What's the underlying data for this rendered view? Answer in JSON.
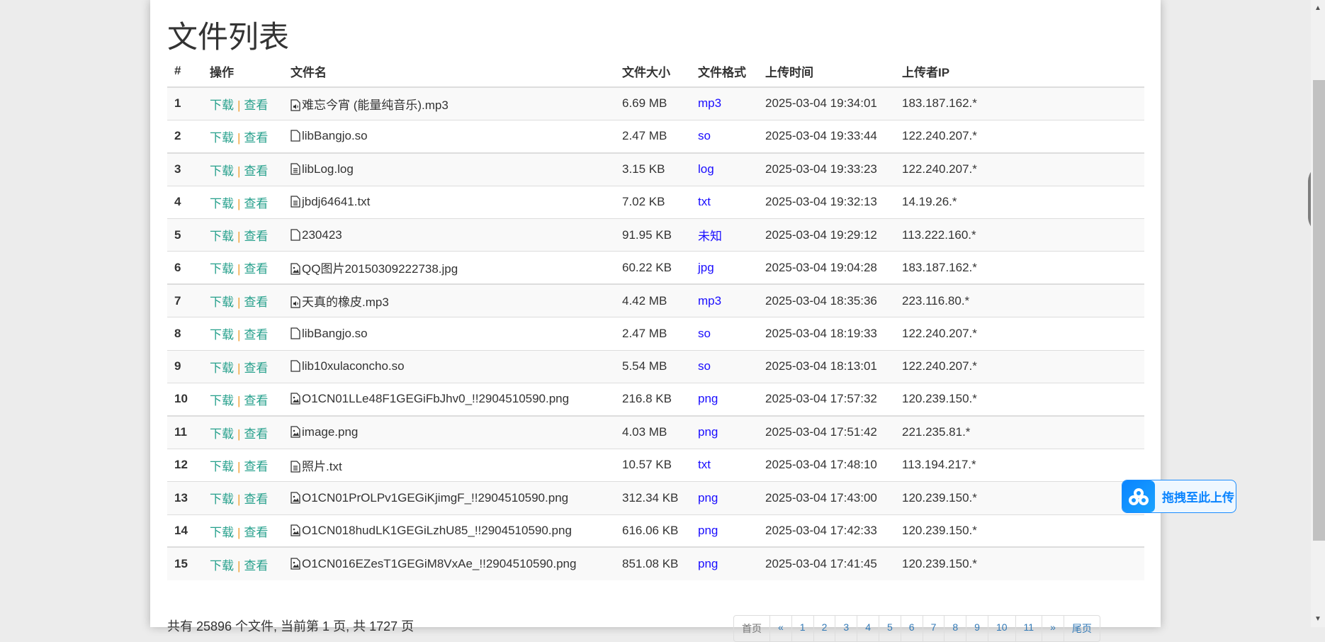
{
  "page_title": "文件列表",
  "headers": [
    "#",
    "操作",
    "文件名",
    "文件大小",
    "文件格式",
    "上传时间",
    "上传者IP"
  ],
  "actions": {
    "download": "下载",
    "separator": "|",
    "view": "查看"
  },
  "rows": [
    {
      "n": "1",
      "icon": "audio-file",
      "name": "难忘今宵 (能量纯音乐).mp3",
      "size": "6.69 MB",
      "fmt": "mp3",
      "time": "2025-03-04 19:34:01",
      "ip": "183.187.162.*"
    },
    {
      "n": "2",
      "icon": "blank-file",
      "name": "libBangjo.so",
      "size": "2.47 MB",
      "fmt": "so",
      "time": "2025-03-04 19:33:44",
      "ip": "122.240.207.*"
    },
    {
      "n": "3",
      "icon": "text-file",
      "name": "libLog.log",
      "size": "3.15 KB",
      "fmt": "log",
      "time": "2025-03-04 19:33:23",
      "ip": "122.240.207.*"
    },
    {
      "n": "4",
      "icon": "text-file",
      "name": "jbdj64641.txt",
      "size": "7.02 KB",
      "fmt": "txt",
      "time": "2025-03-04 19:32:13",
      "ip": "14.19.26.*"
    },
    {
      "n": "5",
      "icon": "blank-file",
      "name": "230423",
      "size": "91.95 KB",
      "fmt": "未知",
      "time": "2025-03-04 19:29:12",
      "ip": "113.222.160.*"
    },
    {
      "n": "6",
      "icon": "image-file",
      "name": "QQ图片20150309222738.jpg",
      "size": "60.22 KB",
      "fmt": "jpg",
      "time": "2025-03-04 19:04:28",
      "ip": "183.187.162.*"
    },
    {
      "n": "7",
      "icon": "audio-file",
      "name": "天真的橡皮.mp3",
      "size": "4.42 MB",
      "fmt": "mp3",
      "time": "2025-03-04 18:35:36",
      "ip": "223.116.80.*"
    },
    {
      "n": "8",
      "icon": "blank-file",
      "name": "libBangjo.so",
      "size": "2.47 MB",
      "fmt": "so",
      "time": "2025-03-04 18:19:33",
      "ip": "122.240.207.*"
    },
    {
      "n": "9",
      "icon": "blank-file",
      "name": "lib10xulaconcho.so",
      "size": "5.54 MB",
      "fmt": "so",
      "time": "2025-03-04 18:13:01",
      "ip": "122.240.207.*"
    },
    {
      "n": "10",
      "icon": "image-file",
      "name": "O1CN01LLe48F1GEGiFbJhv0_!!2904510590.png",
      "size": "216.8 KB",
      "fmt": "png",
      "time": "2025-03-04 17:57:32",
      "ip": "120.239.150.*"
    },
    {
      "n": "11",
      "icon": "image-file",
      "name": "image.png",
      "size": "4.03 MB",
      "fmt": "png",
      "time": "2025-03-04 17:51:42",
      "ip": "221.235.81.*"
    },
    {
      "n": "12",
      "icon": "text-file",
      "name": "照片.txt",
      "size": "10.57 KB",
      "fmt": "txt",
      "time": "2025-03-04 17:48:10",
      "ip": "113.194.217.*"
    },
    {
      "n": "13",
      "icon": "image-file",
      "name": "O1CN01PrOLPv1GEGiKjimgF_!!2904510590.png",
      "size": "312.34 KB",
      "fmt": "png",
      "time": "2025-03-04 17:43:00",
      "ip": "120.239.150.*"
    },
    {
      "n": "14",
      "icon": "image-file",
      "name": "O1CN018hudLK1GEGiLzhU85_!!2904510590.png",
      "size": "616.06 KB",
      "fmt": "png",
      "time": "2025-03-04 17:42:33",
      "ip": "120.239.150.*"
    },
    {
      "n": "15",
      "icon": "image-file",
      "name": "O1CN016EZesT1GEGiM8VxAe_!!2904510590.png",
      "size": "851.08 KB",
      "fmt": "png",
      "time": "2025-03-04 17:41:45",
      "ip": "120.239.150.*"
    }
  ],
  "footer": "共有 25896 个文件, 当前第 1 页, 共 1727 页",
  "pagination": [
    "首页",
    "«",
    "1",
    "2",
    "3",
    "4",
    "5",
    "6",
    "7",
    "8",
    "9",
    "10",
    "11",
    "»",
    "尾页"
  ],
  "upload_button": "拖拽至此上传"
}
